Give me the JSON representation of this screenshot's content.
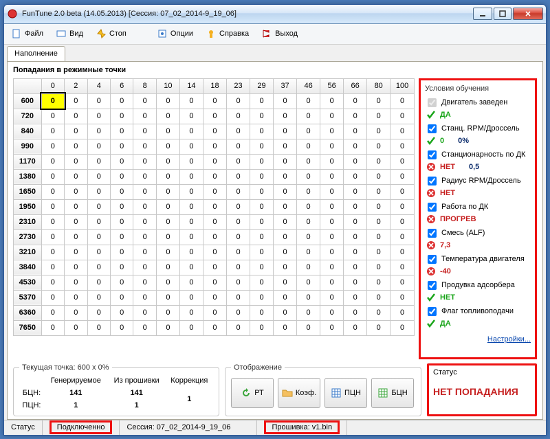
{
  "title": "FunTune 2.0 beta (14.05.2013) [Сессия: 07_02_2014-9_19_06]",
  "menu": {
    "file": "Файл",
    "view": "Вид",
    "stop": "Стоп",
    "options": "Опции",
    "help": "Справка",
    "exit": "Выход"
  },
  "tab": {
    "fill": "Наполнение"
  },
  "page_title": "Попадания в режимные точки",
  "columns": [
    "0",
    "2",
    "4",
    "6",
    "8",
    "10",
    "14",
    "18",
    "23",
    "29",
    "37",
    "46",
    "56",
    "66",
    "80",
    "100"
  ],
  "rows": [
    "600",
    "720",
    "840",
    "990",
    "1170",
    "1380",
    "1650",
    "1950",
    "2310",
    "2730",
    "3210",
    "3840",
    "4530",
    "5370",
    "6360",
    "7650"
  ],
  "cells_all_zero": "0",
  "highlight": {
    "row": 0,
    "col": 0
  },
  "conditions": {
    "legend": "Условия обучения",
    "items": [
      {
        "label": "Двигатель заведен",
        "enabled": false,
        "status": "ok",
        "text": "ДА",
        "extra": ""
      },
      {
        "label": "Станц. RPM/Дроссель",
        "enabled": true,
        "status": "ok",
        "text": "0",
        "extra": "0%"
      },
      {
        "label": "Станционарность по ДК",
        "enabled": true,
        "status": "bad",
        "text": "НЕТ",
        "extra": "0,5"
      },
      {
        "label": "Радиус RPM/Дроссель",
        "enabled": true,
        "status": "bad",
        "text": "НЕТ",
        "extra": ""
      },
      {
        "label": "Работа по ДК",
        "enabled": true,
        "status": "bad",
        "text": "ПРОГРЕВ",
        "extra": ""
      },
      {
        "label": "Смесь (ALF)",
        "enabled": true,
        "status": "bad",
        "text": "7,3",
        "extra": ""
      },
      {
        "label": "Температура двигателя",
        "enabled": true,
        "status": "bad",
        "text": "-40",
        "extra": ""
      },
      {
        "label": "Продувка адсорбера",
        "enabled": true,
        "status": "ok",
        "text": "НЕТ",
        "extra": ""
      },
      {
        "label": "Флаг топливоподачи",
        "enabled": true,
        "status": "ok",
        "text": "ДА",
        "extra": ""
      }
    ],
    "settings_link": "Настройки..."
  },
  "current": {
    "legend": "Текущая точка: 600 x 0%",
    "h_gen": "Генерируемое",
    "h_firm": "Из прошивки",
    "h_corr": "Коррекция",
    "r_bcn": "БЦН:",
    "r_pcn": "ПЦН:",
    "bcn_gen": "141",
    "bcn_firm": "141",
    "pcn_gen": "1",
    "pcn_firm": "1",
    "corr": "1"
  },
  "view": {
    "legend": "Отображение",
    "b1": "РТ",
    "b2": "Коэф.",
    "b3": "ПЦН",
    "b4": "БЦН"
  },
  "status_panel": {
    "legend": "Статус",
    "text": "НЕТ ПОПАДАНИЯ"
  },
  "statusbar": {
    "status_label": "Статус",
    "connected": "Подключенно",
    "session": "Сессия: 07_02_2014-9_19_06",
    "firmware": "Прошивка: v1.bin"
  }
}
